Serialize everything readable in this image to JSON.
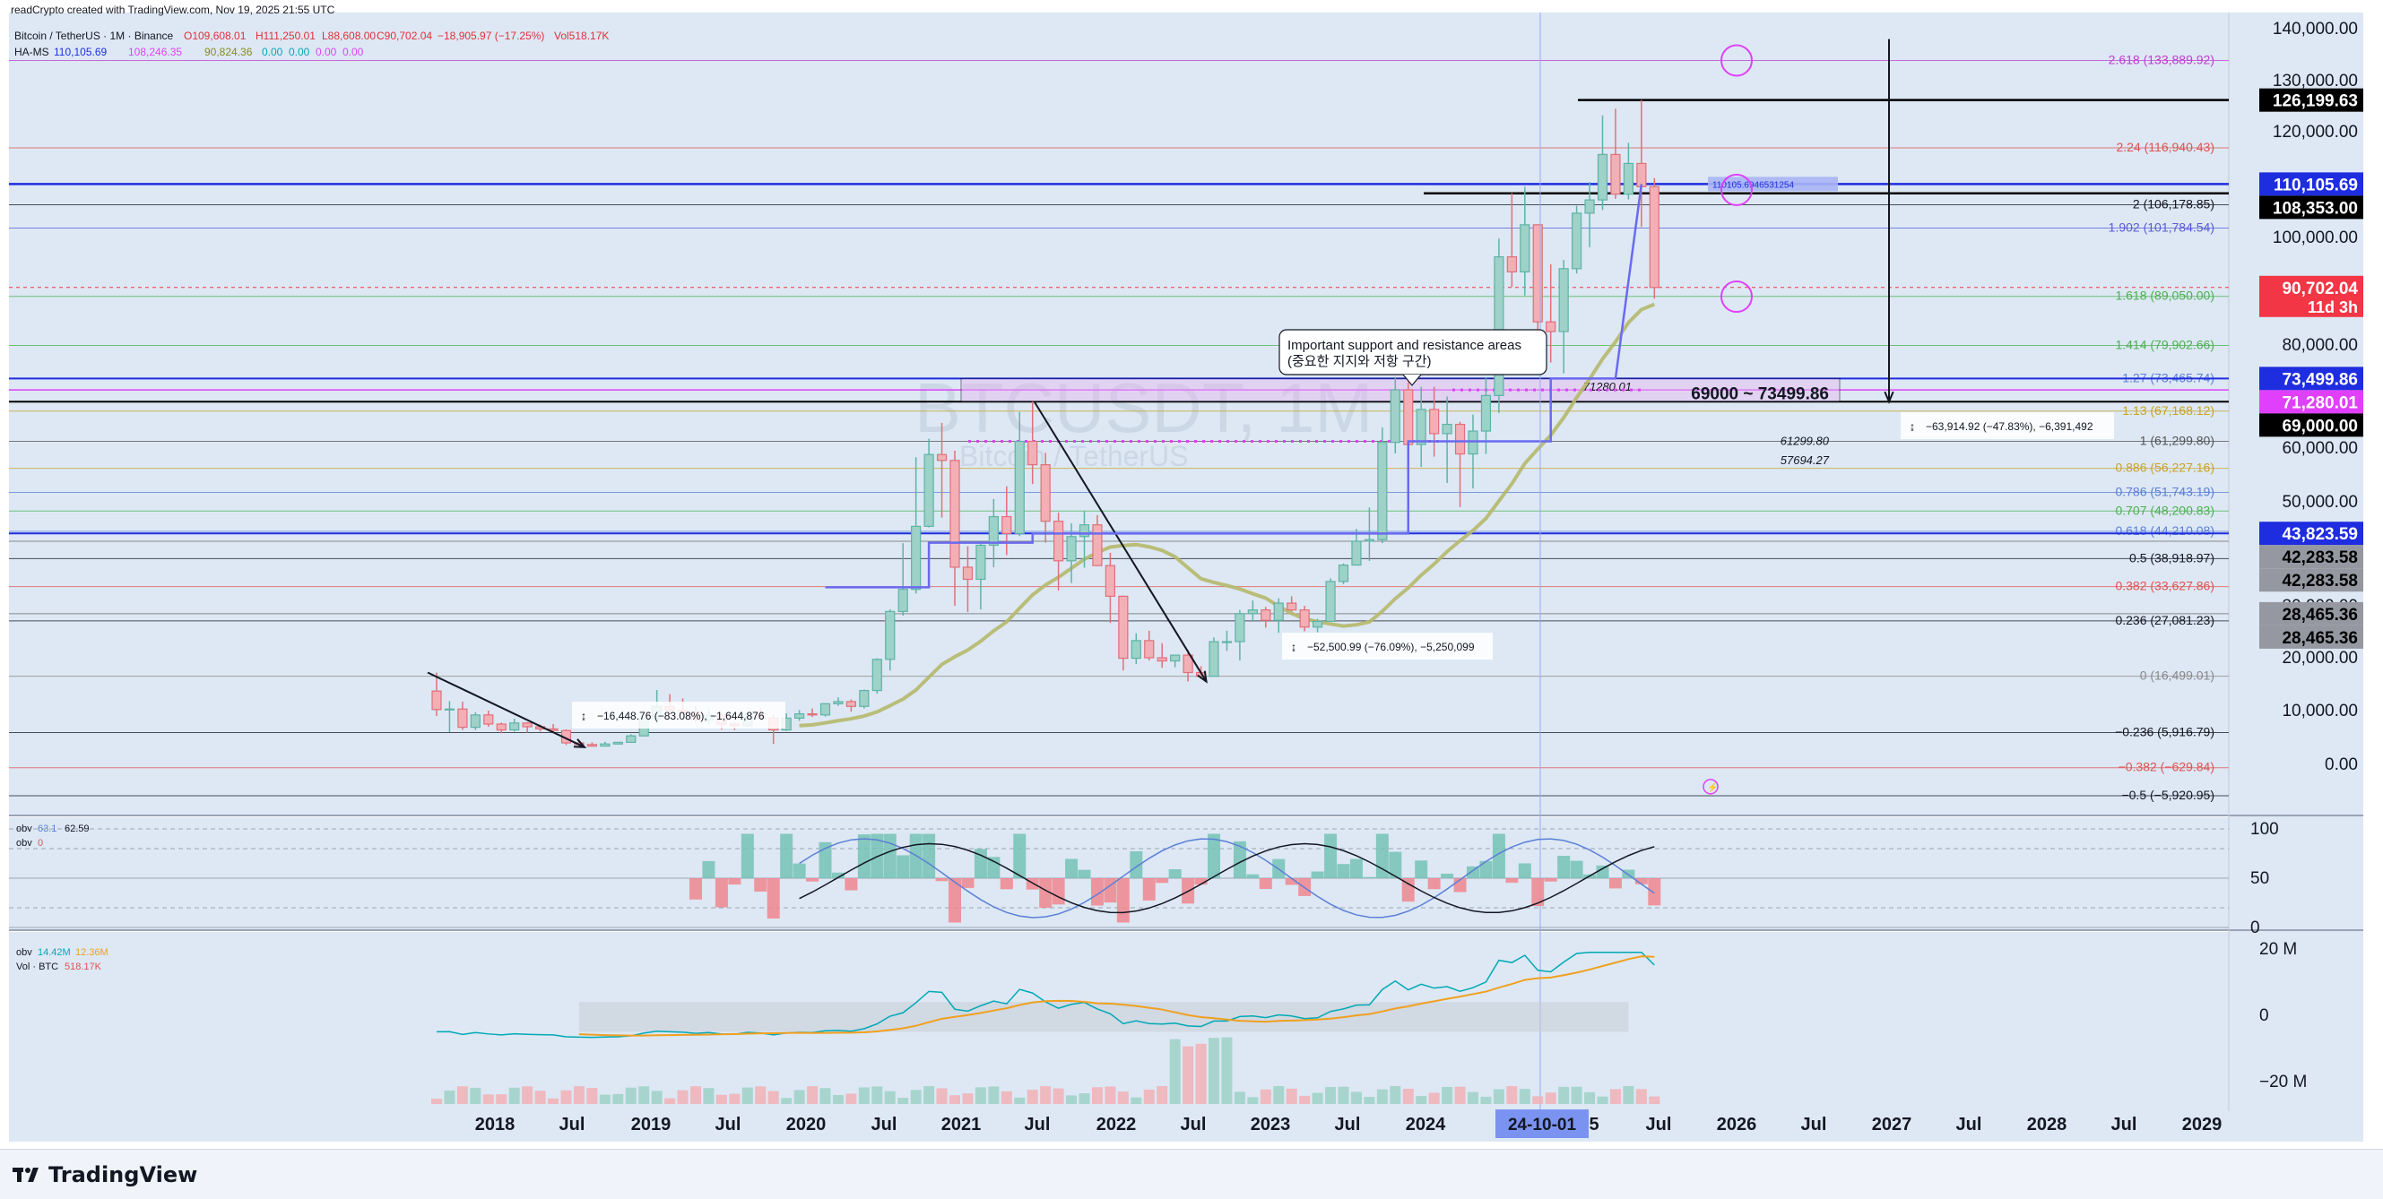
{
  "header": {
    "watermark_top": "readCrypto created with TradingView.com, Nov 19, 2025 21:55 UTC",
    "symbol_line": "Bitcoin / TetherUS · 1M · Binance",
    "ohlc": {
      "o": "O109,608.01",
      "h": "H111,250.01",
      "l": "L88,608.00",
      "c": "C90,702.04",
      "chg": "−18,905.97 (−17.25%)",
      "vol": "Vol518.17K"
    },
    "hams_line": {
      "name": "HA-MS",
      "v1": "110,105.69",
      "v2": "108,246.35",
      "v3": "90,824.36",
      "v4": "0.00",
      "v5": "0.00",
      "v6": "0.00",
      "v7": "0.00"
    }
  },
  "watermark": {
    "symbol": "BTCUSDT, 1M",
    "name": "Bitcoin / TetherUS"
  },
  "annotations": {
    "callout_line1": "Important support and resistance areas",
    "callout_line2": "(중요한 지지와 저항 구간)",
    "zone_label": "69000 ~ 73499.86",
    "level_71280": "71280.01",
    "level_61299": "61299.80",
    "level_57694": "57694.27",
    "hams_tag": "110105.6946531254",
    "measure1": "−16,448.76 (−83.08%), −1,644,876",
    "measure2": "−52,500.99 (−76.09%), −5,250,099",
    "measure3": "−63,914.92 (−47.83%), −6,391,492"
  },
  "fib_labels": [
    {
      "text": "2.618 (133,889.92)",
      "color": "#c23bd4",
      "value": 133889.92
    },
    {
      "text": "2.24 (116,940.43)",
      "color": "#e05252",
      "value": 116940.43
    },
    {
      "text": "2 (106,178.85)",
      "color": "#131722",
      "value": 106178.85
    },
    {
      "text": "1.902 (101,784.54)",
      "color": "#5b5bd6",
      "value": 101784.54
    },
    {
      "text": "1.618 (89,050.00)",
      "color": "#4caf50",
      "value": 89050.0
    },
    {
      "text": "1.414 (79,902.66)",
      "color": "#4caf50",
      "value": 79902.66
    },
    {
      "text": "1.27 (73,465.74)",
      "color": "#5b7fd6",
      "value": 73465.74
    },
    {
      "text": "1.13 (67,168.12)",
      "color": "#c9a227",
      "value": 67168.12
    },
    {
      "text": "1 (61,299.80)",
      "color": "#555555",
      "value": 61299.8
    },
    {
      "text": "0.886 (56,227.16)",
      "color": "#c9a227",
      "value": 56227.16
    },
    {
      "text": "0.786 (51,743.19)",
      "color": "#5b7fd6",
      "value": 51743.19
    },
    {
      "text": "0.707 (48,200.83)",
      "color": "#4caf50",
      "value": 48200.83
    },
    {
      "text": "0.618 (44,210.08)",
      "color": "#5b7fd6",
      "value": 44210.08
    },
    {
      "text": "0.5 (38,918.97)",
      "color": "#131722",
      "value": 38918.97
    },
    {
      "text": "0.382 (33,627.86)",
      "color": "#e05252",
      "value": 33627.86
    },
    {
      "text": "0.236 (27,081.23)",
      "color": "#131722",
      "value": 27081.23
    },
    {
      "text": "0 (16,499.01)",
      "color": "#888888",
      "value": 16499.01
    },
    {
      "text": "−0.236 (5,916.79)",
      "color": "#131722",
      "value": 5916.79
    },
    {
      "text": "−0.382 (−629.84)",
      "color": "#e05252",
      "value": -629.84
    },
    {
      "text": "−0.5 (−5,920.95)",
      "color": "#131722",
      "value": -5920.95
    }
  ],
  "price_axis": {
    "ticks": [
      "140,000.00",
      "130,000.00",
      "120,000.00",
      "100,000.00",
      "80,000.00",
      "60,000.00",
      "50,000.00",
      "40,000.00",
      "30,000.00",
      "20,000.00",
      "10,000.00",
      "0.00"
    ],
    "tick_values": [
      140000,
      130000,
      120000,
      100000,
      80000,
      60000,
      50000,
      40000,
      30000,
      20000,
      10000,
      0
    ],
    "tags": [
      {
        "text": "126,199.63",
        "bg": "#000000",
        "fg": "#ffffff",
        "value": 126199.63
      },
      {
        "text": "110,105.69",
        "bg": "#1f2de0",
        "fg": "#ffffff",
        "value": 110105.69
      },
      {
        "text": "108,353.00",
        "bg": "#000000",
        "fg": "#ffffff",
        "value": 108353.0
      },
      {
        "text": "90,702.04",
        "bg": "#f23645",
        "fg": "#ffffff",
        "value": 90702.04,
        "sub": "11d 3h"
      },
      {
        "text": "73,499.86",
        "bg": "#1f2de0",
        "fg": "#ffffff",
        "value": 73499.86
      },
      {
        "text": "71,280.01",
        "bg": "#e040fb",
        "fg": "#ffffff",
        "value": 71280.01
      },
      {
        "text": "69,000.00",
        "bg": "#000000",
        "fg": "#ffffff",
        "value": 69000.0
      },
      {
        "text": "43,823.59",
        "bg": "#1f2de0",
        "fg": "#ffffff",
        "value": 43823.59
      },
      {
        "text": "42,283.58",
        "bg": "#9598a1",
        "fg": "#000000",
        "value": 42283.58
      },
      {
        "text": "42,283.58",
        "bg": "#9598a1",
        "fg": "#000000",
        "value": 42283.58
      },
      {
        "text": "28,465.36",
        "bg": "#9598a1",
        "fg": "#000000",
        "value": 28465.36
      },
      {
        "text": "28,465.36",
        "bg": "#9598a1",
        "fg": "#000000",
        "value": 28465.36
      }
    ]
  },
  "time_axis": {
    "labels": [
      "2018",
      "Jul",
      "2019",
      "Jul",
      "2020",
      "Jul",
      "2021",
      "Jul",
      "2022",
      "Jul",
      "2023",
      "Jul",
      "2024",
      "5",
      "Jul",
      "2026",
      "Jul",
      "2027",
      "Jul",
      "2028",
      "Jul",
      "2029"
    ],
    "highlight": "24-10-01"
  },
  "obv_panel": {
    "title": "obv",
    "v1": "63.1",
    "v2": "62.59",
    "title2": "obv",
    "v3": "0",
    "ticks": [
      "100",
      "50",
      "0"
    ]
  },
  "vol_panel": {
    "title": "obv",
    "v1": "14.42M",
    "v2": "12.36M",
    "title2": "Vol · BTC",
    "v3": "518.17K",
    "ticks": [
      "20 M",
      "0",
      "−20 M"
    ]
  },
  "footer": {
    "brand": "TradingView"
  },
  "chart_data": {
    "type": "candlestick",
    "symbol": "BTCUSDT",
    "interval": "1M",
    "x": [
      "2018-01",
      "2018-02",
      "2018-03",
      "2018-04",
      "2018-05",
      "2018-06",
      "2018-07",
      "2018-08",
      "2018-09",
      "2018-10",
      "2018-11",
      "2018-12",
      "2019-01",
      "2019-02",
      "2019-03",
      "2019-04",
      "2019-05",
      "2019-06",
      "2019-07",
      "2019-08",
      "2019-09",
      "2019-10",
      "2019-11",
      "2019-12",
      "2020-01",
      "2020-02",
      "2020-03",
      "2020-04",
      "2020-05",
      "2020-06",
      "2020-07",
      "2020-08",
      "2020-09",
      "2020-10",
      "2020-11",
      "2020-12",
      "2021-01",
      "2021-02",
      "2021-03",
      "2021-04",
      "2021-05",
      "2021-06",
      "2021-07",
      "2021-08",
      "2021-09",
      "2021-10",
      "2021-11",
      "2021-12",
      "2022-01",
      "2022-02",
      "2022-03",
      "2022-04",
      "2022-05",
      "2022-06",
      "2022-07",
      "2022-08",
      "2022-09",
      "2022-10",
      "2022-11",
      "2022-12",
      "2023-01",
      "2023-02",
      "2023-03",
      "2023-04",
      "2023-05",
      "2023-06",
      "2023-07",
      "2023-08",
      "2023-09",
      "2023-10",
      "2023-11",
      "2023-12",
      "2024-01",
      "2024-02",
      "2024-03",
      "2024-04",
      "2024-05",
      "2024-06",
      "2024-07",
      "2024-08",
      "2024-09",
      "2024-10",
      "2024-11",
      "2024-12",
      "2025-01",
      "2025-02",
      "2025-03",
      "2025-04",
      "2025-05",
      "2025-06",
      "2025-07",
      "2025-08",
      "2025-09",
      "2025-10",
      "2025-11"
    ],
    "open": [
      13700,
      10200,
      10300,
      6900,
      9200,
      7500,
      6400,
      7700,
      7000,
      6600,
      6300,
      4000,
      3700,
      3400,
      3800,
      4100,
      5300,
      8500,
      10800,
      10100,
      9600,
      8300,
      9200,
      7500,
      7200,
      9400,
      8600,
      6400,
      8600,
      9400,
      9200,
      11300,
      11700,
      10800,
      13800,
      19700,
      28900,
      33100,
      45200,
      58800,
      57700,
      37300,
      35000,
      41500,
      47100,
      43800,
      61300,
      56900,
      46200,
      38500,
      43200,
      45500,
      37600,
      31800,
      19900,
      23300,
      20000,
      19400,
      20500,
      17200,
      16500,
      23100,
      23100,
      28500,
      29200,
      27200,
      30500,
      29200,
      25900,
      27000,
      34600,
      37700,
      42300,
      42600,
      61100,
      71300,
      60700,
      67500,
      62800,
      64600,
      58900,
      63300,
      70200,
      96400,
      93600,
      102400,
      84300,
      82500,
      94200,
      104600,
      107100,
      115700,
      108200,
      114000,
      109600
    ],
    "high": [
      17200,
      11800,
      11700,
      9700,
      10000,
      7800,
      8500,
      7800,
      7400,
      7500,
      6500,
      4300,
      4100,
      4200,
      4100,
      5600,
      9000,
      13900,
      13100,
      12300,
      10900,
      10300,
      9500,
      7700,
      9600,
      10500,
      9200,
      9500,
      10100,
      10400,
      11400,
      12500,
      12100,
      14000,
      19900,
      29300,
      41900,
      58300,
      61800,
      64900,
      59500,
      41300,
      42400,
      50500,
      52900,
      67000,
      69000,
      59100,
      47900,
      45800,
      48200,
      47400,
      40000,
      31900,
      24700,
      25200,
      22800,
      20500,
      21500,
      18400,
      23900,
      25200,
      29200,
      31000,
      29800,
      31400,
      31800,
      30000,
      27500,
      35200,
      38000,
      44700,
      48900,
      64000,
      73800,
      72800,
      71900,
      71900,
      70000,
      65100,
      66500,
      73600,
      99800,
      108400,
      109600,
      102500,
      95000,
      95800,
      106000,
      110500,
      123200,
      124500,
      117900,
      126199,
      111250
    ],
    "low": [
      9000,
      6000,
      6400,
      6400,
      7000,
      5800,
      6100,
      5900,
      6100,
      6100,
      3600,
      3200,
      3400,
      3400,
      3700,
      4100,
      5300,
      7500,
      9100,
      9300,
      7700,
      7300,
      6500,
      6400,
      6900,
      8400,
      3800,
      6200,
      8100,
      8800,
      8900,
      10900,
      9800,
      10400,
      13200,
      17600,
      28100,
      32300,
      45000,
      46900,
      30000,
      28800,
      29300,
      37300,
      39600,
      43300,
      53300,
      42000,
      32900,
      34300,
      37200,
      37500,
      26700,
      17600,
      18800,
      19500,
      18100,
      18200,
      15500,
      16200,
      16500,
      21300,
      19500,
      26900,
      25800,
      24800,
      28900,
      25100,
      24900,
      26900,
      34100,
      37600,
      38500,
      41900,
      59000,
      59100,
      56500,
      58400,
      53500,
      49000,
      52500,
      58900,
      66800,
      90800,
      89200,
      78200,
      76600,
      74500,
      93300,
      98200,
      105200,
      107300,
      107200,
      102000,
      88608
    ],
    "close": [
      10200,
      10300,
      6900,
      9200,
      7500,
      6400,
      7700,
      7000,
      6600,
      6300,
      4000,
      3700,
      3400,
      3800,
      4100,
      5300,
      8500,
      10800,
      10100,
      9600,
      8300,
      9200,
      7500,
      7200,
      9400,
      8600,
      6400,
      8600,
      9400,
      9200,
      11300,
      11700,
      10800,
      13800,
      19700,
      28900,
      33100,
      45200,
      58800,
      57700,
      37300,
      35000,
      41500,
      47100,
      43800,
      61300,
      56900,
      46200,
      38500,
      43200,
      45500,
      37600,
      31800,
      19900,
      23300,
      20000,
      19400,
      20500,
      17200,
      16500,
      23100,
      23100,
      28500,
      29200,
      27200,
      30500,
      29200,
      25900,
      27000,
      34600,
      37700,
      42300,
      42600,
      61100,
      71300,
      60700,
      67500,
      62800,
      64600,
      58900,
      63300,
      70200,
      96400,
      93600,
      102400,
      84300,
      82500,
      94200,
      104600,
      107100,
      115700,
      108200,
      114000,
      109600,
      90702
    ],
    "ylim": [
      -8000,
      140000
    ],
    "grid": false
  }
}
